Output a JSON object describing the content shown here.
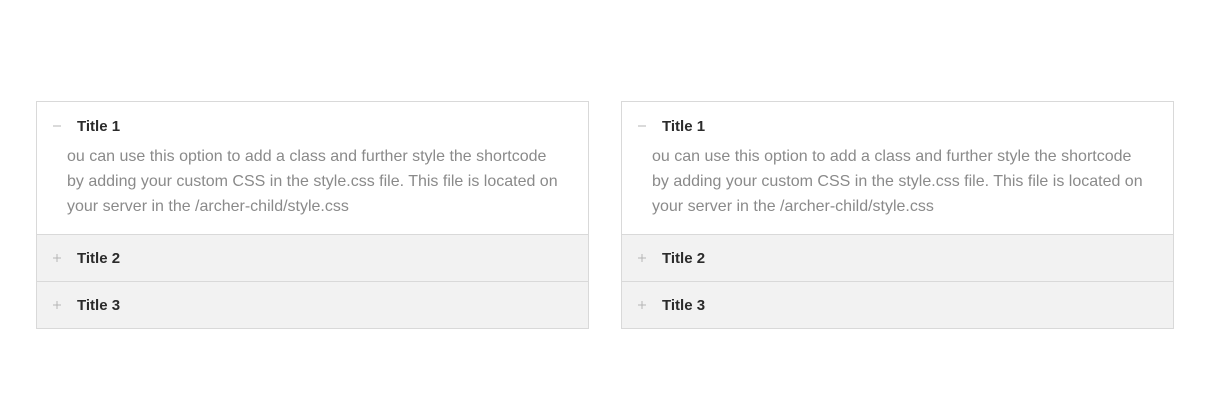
{
  "accordions": [
    {
      "items": [
        {
          "title": "Title 1",
          "state": "open",
          "icon": "minus-icon",
          "content": "ou can use this option to add a class and further style the shortcode by adding your custom CSS in the style.css file. This file is located on your server in the /archer-child/style.css"
        },
        {
          "title": "Title 2",
          "state": "closed",
          "icon": "plus-icon"
        },
        {
          "title": "Title 3",
          "state": "closed",
          "icon": "plus-icon"
        }
      ]
    },
    {
      "items": [
        {
          "title": "Title 1",
          "state": "open",
          "icon": "minus-icon",
          "content": "ou can use this option to add a class and further style the shortcode by adding your custom CSS in the style.css file. This file is located on your server in the /archer-child/style.css"
        },
        {
          "title": "Title 2",
          "state": "closed",
          "icon": "plus-icon"
        },
        {
          "title": "Title 3",
          "state": "closed",
          "icon": "plus-icon"
        }
      ]
    }
  ],
  "colors": {
    "border": "#d9d9d9",
    "closed_header_bg": "#f2f2f2",
    "title": "#2b2b2b",
    "body_text": "#8a8a8a",
    "icon": "#b5b5b5"
  }
}
